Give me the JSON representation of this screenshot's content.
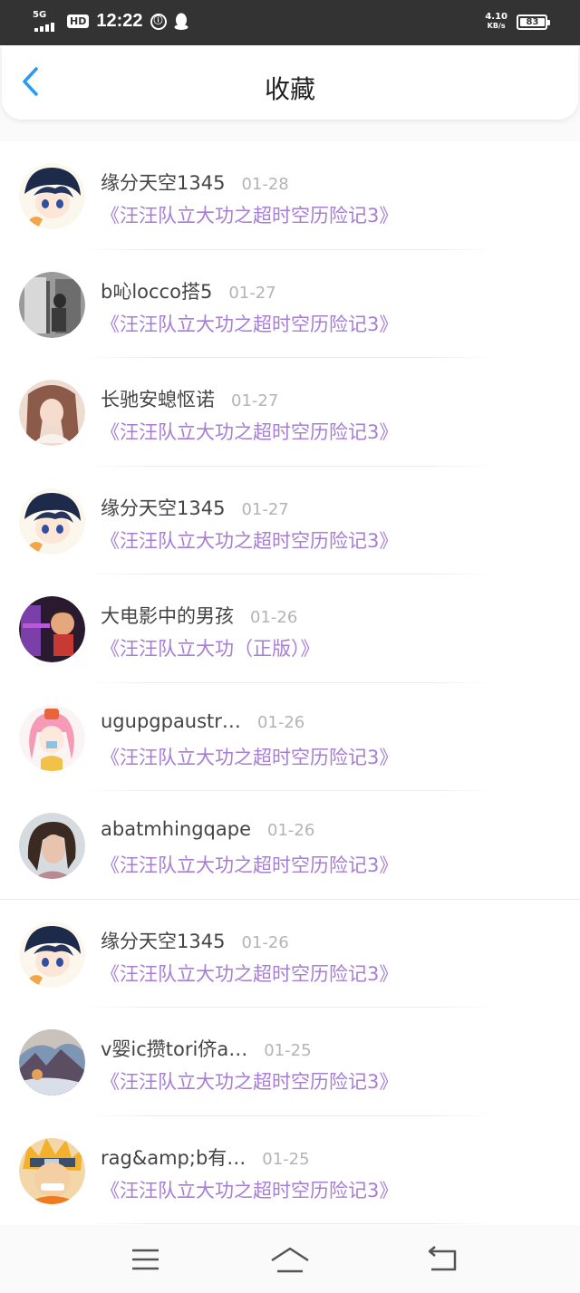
{
  "status_bar": {
    "network": "5G",
    "hd": "HD",
    "time": "12:22",
    "speed_value": "4.10",
    "speed_unit": "KB/s",
    "battery": "83",
    "battery_level": 0.83
  },
  "header": {
    "title": "收藏",
    "back_icon": "chevron-left-icon"
  },
  "colors": {
    "accent_blue": "#2b9af3",
    "title_purple": "#a77dd6",
    "date_gray": "#b4b4b4"
  },
  "favorites": [
    {
      "username": "缘分天空1345",
      "date": "01-28",
      "title": "《汪汪队立大功之超时空历险记3》",
      "avatar": "anime-boy-avatar"
    },
    {
      "username": "b吣locco搭5",
      "date": "01-27",
      "title": "《汪汪队立大功之超时空历险记3》",
      "avatar": "bw-photo-avatar"
    },
    {
      "username": "长驰安螅怄诺",
      "date": "01-27",
      "title": "《汪汪队立大功之超时空历险记3》",
      "avatar": "girl-photo-avatar"
    },
    {
      "username": "缘分天空1345",
      "date": "01-27",
      "title": "《汪汪队立大功之超时空历险记3》",
      "avatar": "anime-boy-avatar"
    },
    {
      "username": "大电影中的男孩",
      "date": "01-26",
      "title": "《汪汪队立大功（正版）》",
      "avatar": "cartoon-boy-avatar"
    },
    {
      "username": "ugupgpaustr…",
      "date": "01-26",
      "title": "《汪汪队立大功之超时空历险记3》",
      "avatar": "pink-anime-avatar"
    },
    {
      "username": "abatmhingqape",
      "date": "01-26",
      "title": "《汪汪队立大功之超时空历险记3》",
      "avatar": "woman-photo-avatar"
    },
    {
      "username": "缘分天空1345",
      "date": "01-26",
      "title": "《汪汪队立大功之超时空历险记3》",
      "avatar": "anime-boy-avatar"
    },
    {
      "username": "v婴ic攒tori侪a…",
      "date": "01-25",
      "title": "《汪汪队立大功之超时空历险记3》",
      "avatar": "landscape-avatar"
    },
    {
      "username": "rag&amp;b有…",
      "date": "01-25",
      "title": "《汪汪队立大功之超时空历险记3》",
      "avatar": "naruto-avatar"
    }
  ],
  "nav_bar": {
    "menu_icon": "menu-icon",
    "home_icon": "home-icon",
    "back_icon": "back-icon"
  }
}
